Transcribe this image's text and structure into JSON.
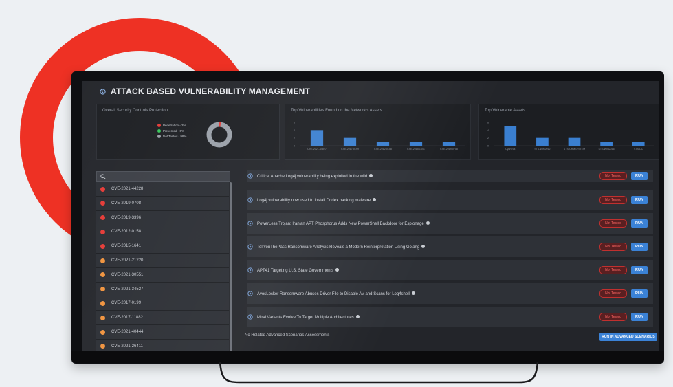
{
  "header": {
    "title": "ATTACK BASED VULNERABILITY MANAGEMENT"
  },
  "cards": {
    "protection": {
      "title": "Overall Security Controls Protection",
      "legend": [
        {
          "label": "Penetration - 2%",
          "color": "#e53935"
        },
        {
          "label": "Prevented - 0%",
          "color": "#35c759"
        },
        {
          "label": "Not Tested - 98%",
          "color": "#9aa0a8"
        }
      ],
      "donut": {
        "penetration": 2,
        "prevented": 0,
        "not_tested": 98
      }
    }
  },
  "chart_data": [
    {
      "type": "bar",
      "title": "Top Vulnerabilities Found on the Network's Assets",
      "categories": [
        "CVE-2021-44827",
        "CVE-2017-0199",
        "CVE-2012-0158",
        "CVE-2015-1641",
        "CVE-2019-0708"
      ],
      "values": [
        4,
        2,
        1,
        1,
        1
      ],
      "ylim": [
        0,
        6
      ],
      "yticks": [
        "6",
        "4",
        "2",
        "0"
      ]
    },
    {
      "type": "bar",
      "title": "Top Vulnerable Assets",
      "categories": [
        "Cyan764",
        "STS-WIN2012",
        "STS-CRMSYSTEM",
        "STS-WIN2016",
        "STS-DC"
      ],
      "values": [
        5,
        2,
        2,
        1,
        1
      ],
      "ylim": [
        0,
        6
      ],
      "yticks": [
        "6",
        "4",
        "2",
        "0"
      ]
    }
  ],
  "search": {
    "placeholder": ""
  },
  "cve_list": [
    {
      "id": "CVE-2021-44228",
      "color": "#e53935"
    },
    {
      "id": "CVE-2019-0708",
      "color": "#e53935"
    },
    {
      "id": "CVE-2019-3396",
      "color": "#e53935"
    },
    {
      "id": "CVE-2012-0158",
      "color": "#e53935"
    },
    {
      "id": "CVE-2015-1641",
      "color": "#e53935"
    },
    {
      "id": "CVE-2021-21220",
      "color": "#f0923c"
    },
    {
      "id": "CVE-2021-30551",
      "color": "#f0923c"
    },
    {
      "id": "CVE-2021-34527",
      "color": "#f0923c"
    },
    {
      "id": "CVE-2017-0199",
      "color": "#f0923c"
    },
    {
      "id": "CVE-2017-11882",
      "color": "#f0923c"
    },
    {
      "id": "CVE-2021-40444",
      "color": "#f0923c"
    },
    {
      "id": "CVE-2021-26411",
      "color": "#f0923c"
    }
  ],
  "news": [
    {
      "text": "Critical Apache Log4j vulnerability being exploited in the wild",
      "status": "Not Tested",
      "action": "RUN"
    },
    {
      "text": "Log4j vulnerability now used to install Dridex banking malware",
      "status": "Not Tested",
      "action": "RUN"
    },
    {
      "text": "PowerLess Trojan: Iranian APT Phosphorus Adds New PowerShell Backdoor for Espionage",
      "status": "Not Tested",
      "action": "RUN"
    },
    {
      "text": "TellYouThePass Ransomware Analysis Reveals a Modern Reinterpretation Using Golang",
      "status": "Not Tested",
      "action": "RUN"
    },
    {
      "text": "APT41 Targeting U.S. State Governments",
      "status": "Not Tested",
      "action": "RUN"
    },
    {
      "text": "AvosLocker Ransomware Abuses Driver File to Disable AV and Scans for Log4shell",
      "status": "Not Tested",
      "action": "RUN"
    },
    {
      "text": "Mirai Variants Evolve To Target Multiple Architectures",
      "status": "Not Tested",
      "action": "RUN"
    }
  ],
  "footer": {
    "note": "No Related Advanced Scenarios Assessments",
    "button": "RUN IN ADVANCED SCENARIOS"
  },
  "colors": {
    "accent": "#3b82d6",
    "brand_ring": "#ee3124",
    "danger": "#e53935",
    "warning": "#f0923c"
  }
}
